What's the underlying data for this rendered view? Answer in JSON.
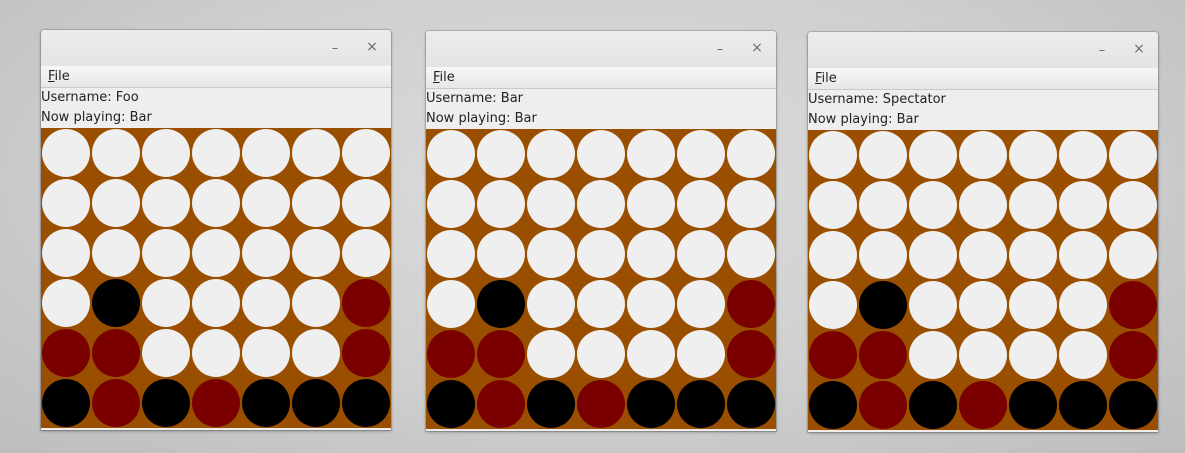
{
  "colors": {
    "board": "#9a4e00",
    "empty": "#efefef",
    "red": "#7a0000",
    "black": "#000000"
  },
  "windows": [
    {
      "id": "window-foo",
      "controls": {
        "minimize": "–",
        "close": "×"
      },
      "menu": {
        "file": {
          "mnemonic": "F",
          "rest": "ile"
        }
      },
      "username_label": "Username: Foo",
      "now_playing_label": "Now playing: Bar",
      "board": [
        [
          "E",
          "E",
          "E",
          "E",
          "E",
          "E",
          "E"
        ],
        [
          "E",
          "E",
          "E",
          "E",
          "E",
          "E",
          "E"
        ],
        [
          "E",
          "E",
          "E",
          "E",
          "E",
          "E",
          "E"
        ],
        [
          "E",
          "B",
          "E",
          "E",
          "E",
          "E",
          "R"
        ],
        [
          "R",
          "R",
          "E",
          "E",
          "E",
          "E",
          "R"
        ],
        [
          "B",
          "R",
          "B",
          "R",
          "B",
          "B",
          "B"
        ]
      ]
    },
    {
      "id": "window-bar",
      "controls": {
        "minimize": "–",
        "close": "×"
      },
      "menu": {
        "file": {
          "mnemonic": "F",
          "rest": "ile"
        }
      },
      "username_label": "Username: Bar",
      "now_playing_label": "Now playing: Bar",
      "board": [
        [
          "E",
          "E",
          "E",
          "E",
          "E",
          "E",
          "E"
        ],
        [
          "E",
          "E",
          "E",
          "E",
          "E",
          "E",
          "E"
        ],
        [
          "E",
          "E",
          "E",
          "E",
          "E",
          "E",
          "E"
        ],
        [
          "E",
          "B",
          "E",
          "E",
          "E",
          "E",
          "R"
        ],
        [
          "R",
          "R",
          "E",
          "E",
          "E",
          "E",
          "R"
        ],
        [
          "B",
          "R",
          "B",
          "R",
          "B",
          "B",
          "B"
        ]
      ]
    },
    {
      "id": "window-spectator",
      "controls": {
        "minimize": "–",
        "close": "×"
      },
      "menu": {
        "file": {
          "mnemonic": "F",
          "rest": "ile"
        }
      },
      "username_label": "Username: Spectator",
      "now_playing_label": "Now playing: Bar",
      "board": [
        [
          "E",
          "E",
          "E",
          "E",
          "E",
          "E",
          "E"
        ],
        [
          "E",
          "E",
          "E",
          "E",
          "E",
          "E",
          "E"
        ],
        [
          "E",
          "E",
          "E",
          "E",
          "E",
          "E",
          "E"
        ],
        [
          "E",
          "B",
          "E",
          "E",
          "E",
          "E",
          "R"
        ],
        [
          "R",
          "R",
          "E",
          "E",
          "E",
          "E",
          "R"
        ],
        [
          "B",
          "R",
          "B",
          "R",
          "B",
          "B",
          "B"
        ]
      ]
    }
  ]
}
